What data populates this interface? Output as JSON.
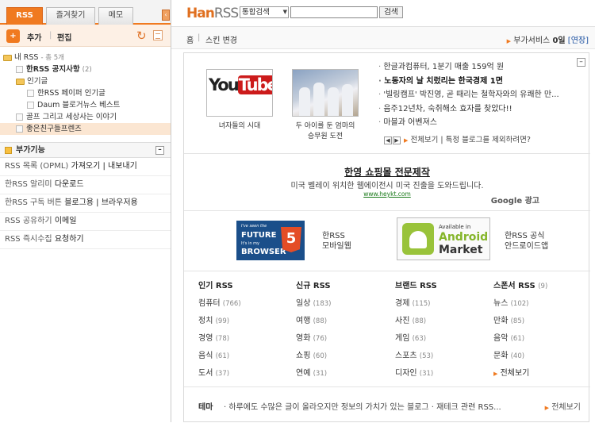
{
  "sidebar": {
    "tabs": [
      "RSS",
      "즐겨찾기",
      "메모"
    ],
    "toolbar": {
      "add_label": "추가",
      "edit_label": "편집"
    },
    "tree": {
      "root_label": "내 RSS",
      "root_count": "- 총 5개",
      "items": [
        {
          "label": "한RSS 공지사항",
          "count": "(2)"
        },
        {
          "label": "인기글",
          "children": [
            "한RSS 페이퍼 인기글",
            "Daum 블로거뉴스 베스트"
          ]
        },
        {
          "label": "골프 그리고 세상사는 이야기"
        },
        {
          "label": "좋은친구들프렌즈"
        }
      ]
    },
    "addons": {
      "title": "부가기능",
      "items": [
        {
          "pre": "RSS 목록 (OPML)",
          "link": "가져오기 | 내보내기"
        },
        {
          "pre": "한RSS 알리미",
          "link": "다운로드"
        },
        {
          "pre": "한RSS 구독 버튼",
          "link": "블로그용 | 브라우저용"
        },
        {
          "pre": "RSS 공유하기",
          "link": "이메일"
        },
        {
          "pre": "RSS 즉시수집",
          "link": "요청하기"
        }
      ]
    }
  },
  "header": {
    "logo_han": "Han",
    "logo_rss": "RSS",
    "search_select": "통합검색",
    "search_value": "",
    "search_button": "검색"
  },
  "crumb": {
    "home": "홈",
    "skin": "스킨 변경",
    "addon_service": "부가서비스",
    "addon_count": "0일",
    "addon_link": "[연장]"
  },
  "news": {
    "thumb1_caption": "녀자들의 시대",
    "thumb2_caption_1": "두 아이를 둔 엄마의",
    "thumb2_caption_2": "승무원 도전",
    "youtube_you": "You",
    "youtube_tube": "Tube",
    "headlines": [
      {
        "text": "한글과컴퓨터, 1분기 매출 159억 원",
        "bold": false
      },
      {
        "text": "노동자의 날 치렀리는 한국경제 1면",
        "bold": true
      },
      {
        "text": "'빌링캠프' 박진영, 곧 때리는 철학자와의 유쾌한 만...",
        "bold": false
      },
      {
        "text": "음주12년차, 숙취해소 효자를 찾았다!!",
        "bold": false
      },
      {
        "text": "마블과 어벤져스",
        "bold": false
      }
    ],
    "nav_text": "전체보기 | 특정 블로그를 제외하려면?"
  },
  "ad": {
    "title": "한영 쇼핑몰 전문제작",
    "desc": "미국 벨레이 위치한 웹에이전시 미국 진출을 도와드립니다.",
    "url": "www.heykt.com",
    "google_label": "Google 광고"
  },
  "apps": {
    "html5_line1": "I've seen the",
    "html5_line2": "FUTURE",
    "html5_line3": "It's in my",
    "html5_line4": "BROWSER",
    "html5_badge": "5",
    "web_label_1": "한RSS",
    "web_label_2": "모바일웹",
    "android_avail": "Available in",
    "android_word": "Android",
    "market_word": "Market",
    "android_label_1": "한RSS 공식",
    "android_label_2": "안드로이드앱"
  },
  "categories": [
    {
      "header": "인기 RSS",
      "header_count": "",
      "items": [
        {
          "name": "컴퓨터",
          "count": "(766)"
        },
        {
          "name": "정치",
          "count": "(99)"
        },
        {
          "name": "경영",
          "count": "(78)"
        },
        {
          "name": "음식",
          "count": "(61)"
        },
        {
          "name": "도서",
          "count": "(37)"
        }
      ]
    },
    {
      "header": "신규 RSS",
      "header_count": "",
      "items": [
        {
          "name": "일상",
          "count": "(183)"
        },
        {
          "name": "여행",
          "count": "(88)"
        },
        {
          "name": "영화",
          "count": "(76)"
        },
        {
          "name": "쇼핑",
          "count": "(60)"
        },
        {
          "name": "연예",
          "count": "(31)"
        }
      ]
    },
    {
      "header": "브랜드 RSS",
      "header_count": "",
      "items": [
        {
          "name": "경제",
          "count": "(115)"
        },
        {
          "name": "사진",
          "count": "(88)"
        },
        {
          "name": "게임",
          "count": "(63)"
        },
        {
          "name": "스포츠",
          "count": "(53)"
        },
        {
          "name": "디자인",
          "count": "(31)"
        }
      ]
    },
    {
      "header": "스폰서 RSS",
      "header_count": "(9)",
      "items": [
        {
          "name": "뉴스",
          "count": "(102)"
        },
        {
          "name": "만화",
          "count": "(85)"
        },
        {
          "name": "음악",
          "count": "(61)"
        },
        {
          "name": "문화",
          "count": "(40)"
        }
      ],
      "more": "전체보기"
    }
  ],
  "theme": {
    "label": "테마",
    "text": "· 하루에도 수많은 글이 올라오지만 정보의 가치가 있는 블로그  · 재테크 관련 RSS...",
    "more": "전체보기"
  },
  "colors": {
    "accent": "#f07a20",
    "link": "#1a4fa0"
  },
  "icons": [
    "rss-icon",
    "refresh-icon",
    "list-icon",
    "folder-icon",
    "feed-icon",
    "minus-icon",
    "triangle-icon"
  ]
}
